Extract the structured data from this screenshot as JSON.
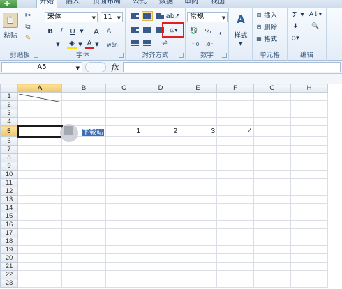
{
  "app": {
    "file_tab": "开始"
  },
  "tabs": [
    "开始",
    "插入",
    "页面布局",
    "公式",
    "数据",
    "审阅",
    "视图"
  ],
  "clipboard": {
    "paste_label": "粘贴",
    "group_label": "剪贴板"
  },
  "font": {
    "name": "宋体",
    "size": "11",
    "bold": "B",
    "italic": "I",
    "underline": "U",
    "grow": "A",
    "shrink": "A",
    "font_color": "A",
    "wen": "wén",
    "group_label": "字体"
  },
  "alignment": {
    "group_label": "对齐方式"
  },
  "number": {
    "format": "常规",
    "percent": "%",
    "comma": ",",
    "group_label": "数字"
  },
  "styles": {
    "label": "样式"
  },
  "cells": {
    "insert": "插入",
    "delete": "删除",
    "format": "格式",
    "group_label": "单元格"
  },
  "editing": {
    "sum": "Σ",
    "group_label": "编辑"
  },
  "formula_bar": {
    "name_box": "A5",
    "fx": "fx",
    "value": ""
  },
  "sheet": {
    "columns": [
      "A",
      "B",
      "C",
      "D",
      "E",
      "F",
      "G",
      "H"
    ],
    "rows": [
      "1",
      "2",
      "3",
      "4",
      "5",
      "6",
      "7",
      "8",
      "9",
      "10",
      "11",
      "12",
      "13",
      "14",
      "15",
      "16",
      "17",
      "18",
      "19",
      "20",
      "21",
      "22",
      "23"
    ],
    "b5": "下载站",
    "c5": "1",
    "d5": "2",
    "e5": "3",
    "f5": "4"
  },
  "colors": {
    "accent": "#e02020",
    "selection": "#f1c55f"
  }
}
